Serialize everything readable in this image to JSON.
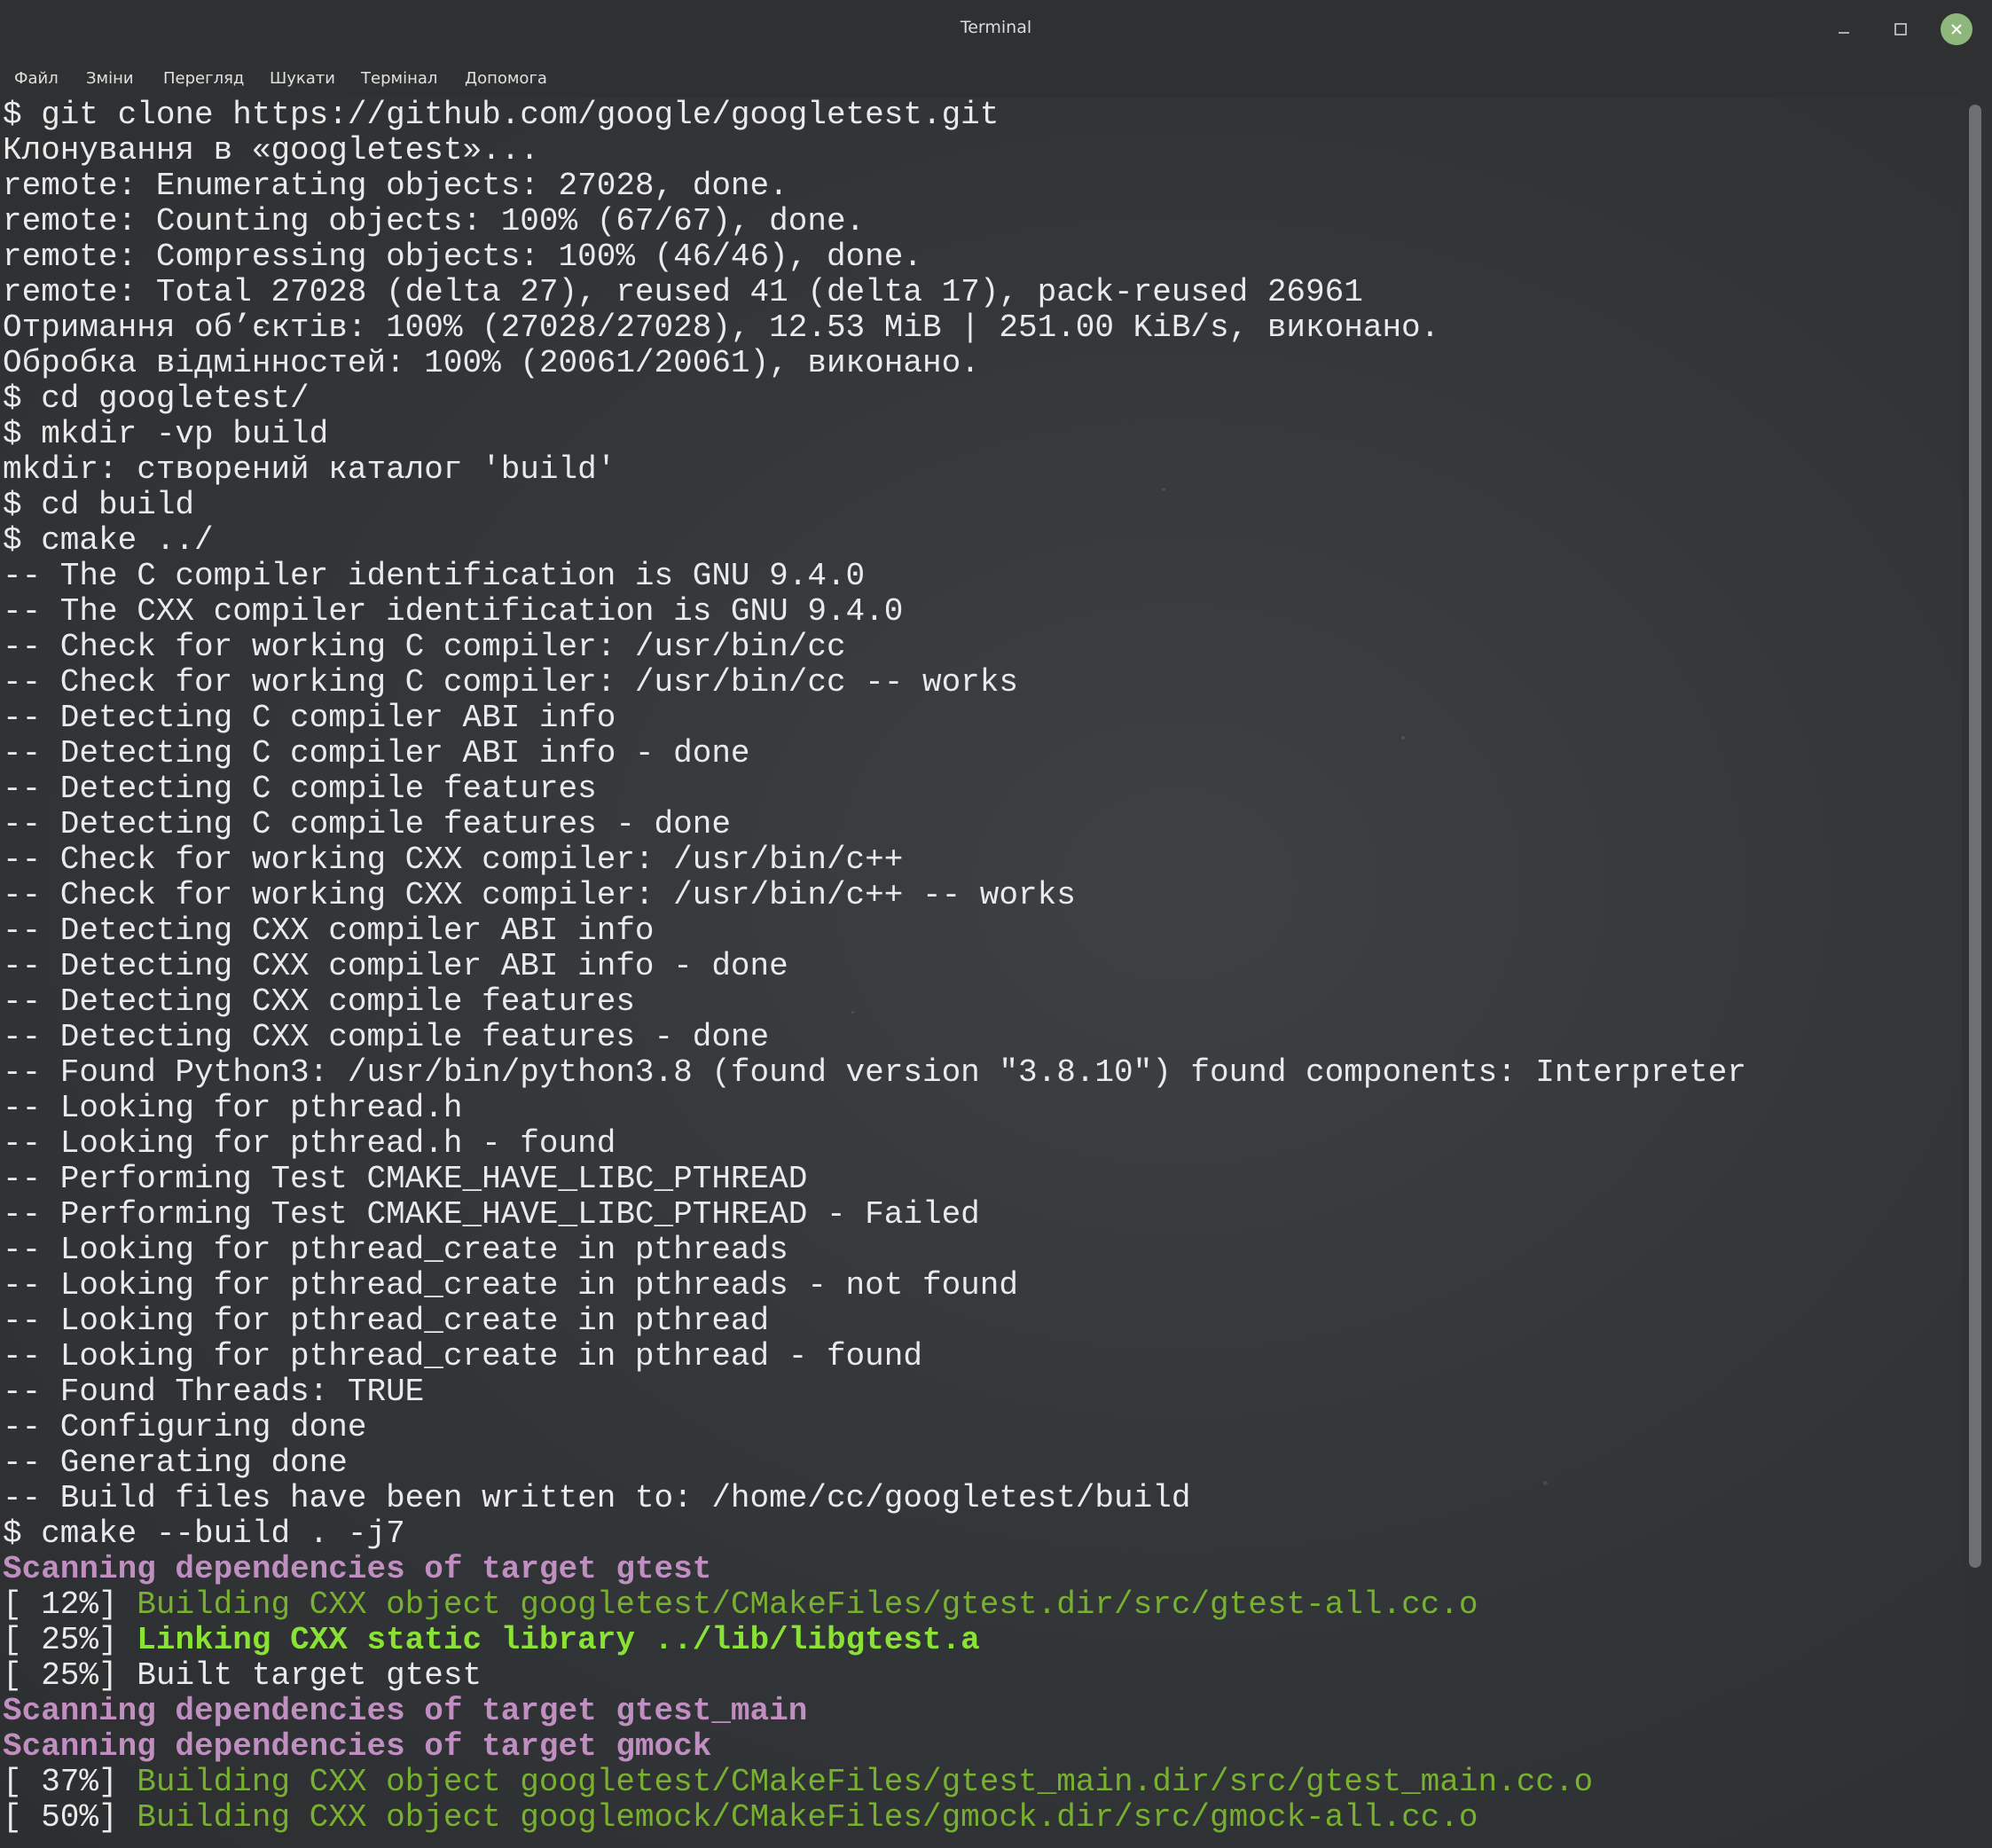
{
  "window": {
    "title": "Terminal",
    "minimize_glyph": "–",
    "maximize_glyph": "☐",
    "close_glyph": "✕",
    "close_color": "#8fb67b"
  },
  "menu": [
    "Файл",
    "Зміни",
    "Перегляд",
    "Шукати",
    "Термінал",
    "Допомога"
  ],
  "terminal": {
    "colors": {
      "text": "#eaeaea",
      "scan": "#c08ec0",
      "build": "#78b02f",
      "link": "#8ae234"
    },
    "lines": [
      {
        "text": "$ git clone https://github.com/google/googletest.git"
      },
      {
        "text": "Клонування в «googletest»..."
      },
      {
        "text": "remote: Enumerating objects: 27028, done."
      },
      {
        "text": "remote: Counting objects: 100% (67/67), done."
      },
      {
        "text": "remote: Compressing objects: 100% (46/46), done."
      },
      {
        "text": "remote: Total 27028 (delta 27), reused 41 (delta 17), pack-reused 26961"
      },
      {
        "text": "Отримання об’єктів: 100% (27028/27028), 12.53 MiB | 251.00 KiB/s, виконано."
      },
      {
        "text": "Обробка відмінностей: 100% (20061/20061), виконано."
      },
      {
        "text": "$ cd googletest/"
      },
      {
        "text": "$ mkdir -vp build"
      },
      {
        "text": "mkdir: створений каталог 'build'"
      },
      {
        "text": "$ cd build"
      },
      {
        "text": "$ cmake ../"
      },
      {
        "text": "-- The C compiler identification is GNU 9.4.0"
      },
      {
        "text": "-- The CXX compiler identification is GNU 9.4.0"
      },
      {
        "text": "-- Check for working C compiler: /usr/bin/cc"
      },
      {
        "text": "-- Check for working C compiler: /usr/bin/cc -- works"
      },
      {
        "text": "-- Detecting C compiler ABI info"
      },
      {
        "text": "-- Detecting C compiler ABI info - done"
      },
      {
        "text": "-- Detecting C compile features"
      },
      {
        "text": "-- Detecting C compile features - done"
      },
      {
        "text": "-- Check for working CXX compiler: /usr/bin/c++"
      },
      {
        "text": "-- Check for working CXX compiler: /usr/bin/c++ -- works"
      },
      {
        "text": "-- Detecting CXX compiler ABI info"
      },
      {
        "text": "-- Detecting CXX compiler ABI info - done"
      },
      {
        "text": "-- Detecting CXX compile features"
      },
      {
        "text": "-- Detecting CXX compile features - done"
      },
      {
        "text": "-- Found Python3: /usr/bin/python3.8 (found version \"3.8.10\") found components: Interpreter"
      },
      {
        "text": "-- Looking for pthread.h"
      },
      {
        "text": "-- Looking for pthread.h - found"
      },
      {
        "text": "-- Performing Test CMAKE_HAVE_LIBC_PTHREAD"
      },
      {
        "text": "-- Performing Test CMAKE_HAVE_LIBC_PTHREAD - Failed"
      },
      {
        "text": "-- Looking for pthread_create in pthreads"
      },
      {
        "text": "-- Looking for pthread_create in pthreads - not found"
      },
      {
        "text": "-- Looking for pthread_create in pthread"
      },
      {
        "text": "-- Looking for pthread_create in pthread - found"
      },
      {
        "text": "-- Found Threads: TRUE"
      },
      {
        "text": "-- Configuring done"
      },
      {
        "text": "-- Generating done"
      },
      {
        "text": "-- Build files have been written to: /home/cc/googletest/build"
      },
      {
        "text": "$ cmake --build . -j7"
      },
      {
        "style": "scan",
        "text": "Scanning dependencies of target gtest"
      },
      {
        "prefix": "[ 12%] ",
        "style": "build",
        "text": "Building CXX object googletest/CMakeFiles/gtest.dir/src/gtest-all.cc.o"
      },
      {
        "prefix": "[ 25%] ",
        "style": "link",
        "text": "Linking CXX static library ../lib/libgtest.a"
      },
      {
        "prefix": "[ 25%] ",
        "text": "Built target gtest"
      },
      {
        "style": "scan",
        "text": "Scanning dependencies of target gtest_main"
      },
      {
        "style": "scan",
        "text": "Scanning dependencies of target gmock"
      },
      {
        "prefix": "[ 37%] ",
        "style": "build",
        "text": "Building CXX object googletest/CMakeFiles/gtest_main.dir/src/gtest_main.cc.o"
      },
      {
        "prefix": "[ 50%] ",
        "style": "build",
        "text": "Building CXX object googlemock/CMakeFiles/gmock.dir/src/gmock-all.cc.o"
      }
    ]
  }
}
